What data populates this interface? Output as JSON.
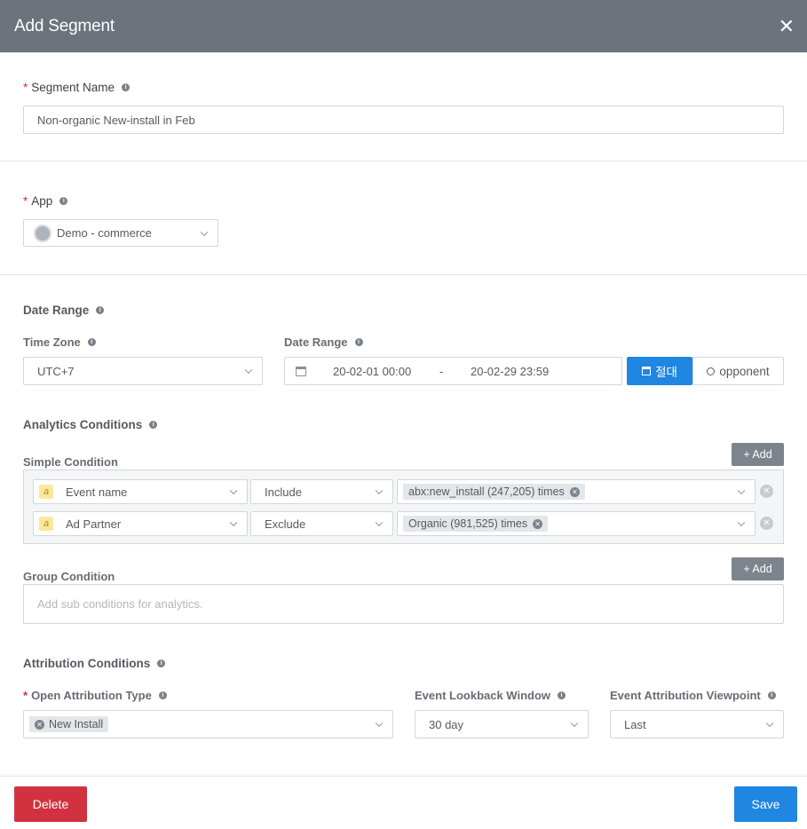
{
  "header": {
    "title": "Add Segment",
    "close_glyph": "✕"
  },
  "segment_name": {
    "label": "Segment Name",
    "value": "Non-organic New-install in Feb"
  },
  "app": {
    "label": "App",
    "value": "Demo - commerce"
  },
  "date_range_section": {
    "title": "Date Range",
    "time_zone_label": "Time Zone",
    "time_zone_value": "UTC+7",
    "date_range_label": "Date Range",
    "start": "20-02-01 00:00",
    "separator": "-",
    "end": "20-02-29 23:59",
    "absolute_button": "절대",
    "relative_button": "opponent"
  },
  "analytics": {
    "title": "Analytics Conditions",
    "simple_label": "Simple Condition",
    "add_label": "+ Add",
    "rows": [
      {
        "badge": "a",
        "field": "Event name",
        "operator": "Include",
        "tag": "abx:new_install (247,205) times"
      },
      {
        "badge": "a",
        "field": "Ad Partner",
        "operator": "Exclude",
        "tag": "Organic (981,525) times"
      }
    ],
    "group_label": "Group Condition",
    "group_placeholder": "Add sub conditions for analytics."
  },
  "attribution": {
    "title": "Attribution Conditions",
    "type_label": "Open Attribution Type",
    "type_tag": "New Install",
    "lookback_label": "Event Lookback Window",
    "lookback_value": "30 day",
    "viewpoint_label": "Event Attribution Viewpoint",
    "viewpoint_value": "Last"
  },
  "footer": {
    "delete_label": "Delete",
    "save_label": "Save"
  },
  "colors": {
    "header_bg": "#6c737c",
    "primary": "#1f86e2",
    "danger": "#d2323f",
    "required": "#d0313e"
  },
  "icons": [
    "close-icon",
    "info-icon",
    "app-logo",
    "calendar-icon",
    "location-icon",
    "chevron-down-icon",
    "remove-icon"
  ]
}
